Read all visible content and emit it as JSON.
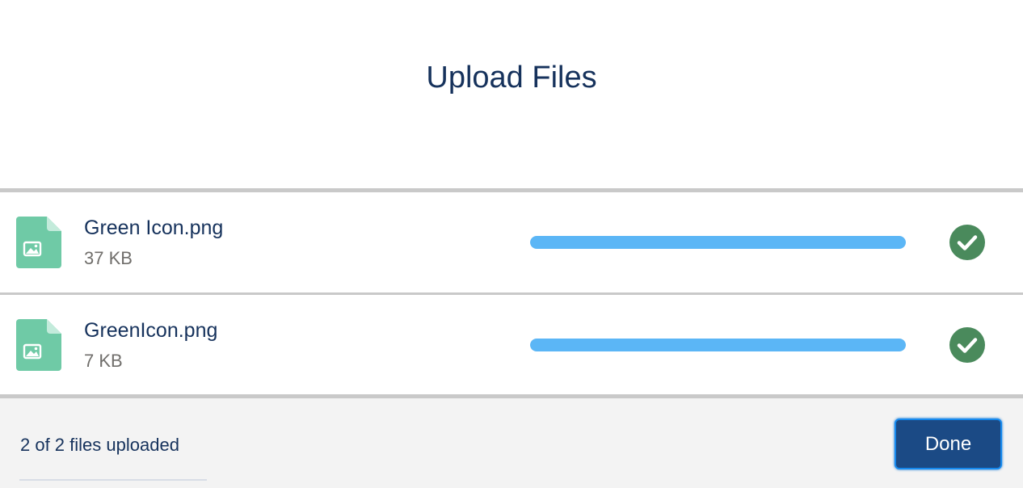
{
  "header": {
    "title": "Upload Files"
  },
  "files": [
    {
      "name": "Green Icon.png",
      "size": "37 KB",
      "progress_percent": 100,
      "status": "complete",
      "icon": "image-file-icon"
    },
    {
      "name": "GreenIcon.png",
      "size": "7 KB",
      "progress_percent": 100,
      "status": "complete",
      "icon": "image-file-icon"
    }
  ],
  "footer": {
    "status_text": "2 of 2 files uploaded",
    "done_label": "Done"
  },
  "colors": {
    "title": "#16325c",
    "file_icon": "#6fcaa6",
    "progress_fill": "#5bb6f6",
    "success": "#4a8a5c",
    "done_button": "#1b4a85"
  }
}
